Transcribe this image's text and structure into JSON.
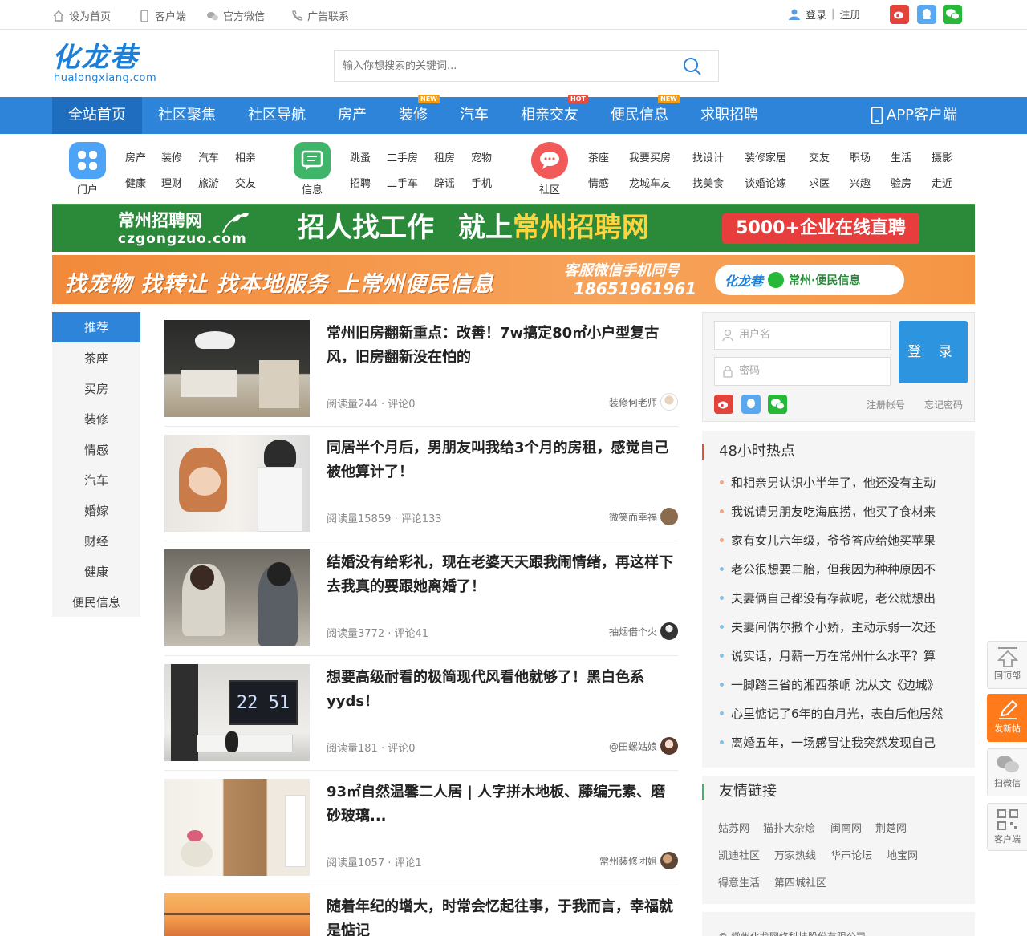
{
  "topbar": {
    "links": [
      "设为首页",
      "客户端",
      "官方微信",
      "广告联系"
    ],
    "login": "登录",
    "separator": "|",
    "register": "注册"
  },
  "logo": {
    "text": "化龙巷",
    "domain": "hualongxiang.com"
  },
  "search": {
    "placeholder": "输入你想搜索的关键词..."
  },
  "nav": {
    "items": [
      "全站首页",
      "社区聚焦",
      "社区导航",
      "房产",
      "装修",
      "汽车",
      "相亲交友",
      "便民信息",
      "求职招聘"
    ],
    "badges": {
      "装修": "NEW",
      "相亲交友": "HOT",
      "便民信息": "NEW"
    },
    "app": "APP客户端",
    "active": "全站首页"
  },
  "catnav": {
    "groups": [
      {
        "label": "门户",
        "links": [
          "房产",
          "装修",
          "汽车",
          "相亲",
          "健康",
          "理财",
          "旅游",
          "交友"
        ]
      },
      {
        "label": "信息",
        "links": [
          "跳蚤",
          "二手房",
          "租房",
          "宠物",
          "招聘",
          "二手车",
          "辟谣",
          "手机"
        ]
      },
      {
        "label": "社区",
        "links": [
          "茶座",
          "我要买房",
          "找设计",
          "装修家居",
          "交友",
          "职场",
          "生活",
          "摄影",
          "情感",
          "龙城车友",
          "找美食",
          "谈婚论嫁",
          "求医",
          "兴趣",
          "验房",
          "走近"
        ]
      }
    ]
  },
  "banner1": {
    "brand": "常州招聘网",
    "brand_domain": "czgongzuo.com",
    "slogan_a": "招人找工作",
    "slogan_b": "就上",
    "slogan_c": "常州招聘网",
    "cta": "5000+企业在线直聘"
  },
  "banner2": {
    "slogan": "找宠物 找转让 找本地服务 上常州便民信息",
    "service_label": "客服微信手机同号",
    "phone": "18651961961",
    "pill_brand": "化龙巷",
    "pill_text": "常州·便民信息"
  },
  "sidebar": {
    "items": [
      "推荐",
      "茶座",
      "买房",
      "装修",
      "情感",
      "汽车",
      "婚嫁",
      "财经",
      "健康",
      "便民信息"
    ],
    "active": "推荐"
  },
  "articles": [
    {
      "title": "常州旧房翻新重点：改善！7w搞定80㎡小户型复古风，旧房翻新没在怕的",
      "meta": "阅读量244 · 评论0",
      "author": "装修何老师"
    },
    {
      "title": "同居半个月后，男朋友叫我给3个月的房租，感觉自己被他算计了！",
      "meta": "阅读量15859 · 评论133",
      "author": "微笑而幸福"
    },
    {
      "title": "结婚没有给彩礼，现在老婆天天跟我闹情绪，再这样下去我真的要跟她离婚了！",
      "meta": "阅读量3772 · 评论41",
      "author": "抽烟借个火"
    },
    {
      "title": "想要高级耐看的极简现代风看他就够了！黑白色系yyds！",
      "meta": "阅读量181 · 评论0",
      "author": "@田螺姑娘",
      "tv_clock": "22 51"
    },
    {
      "title": "93㎡自然温馨二人居 | 人字拼木地板、藤编元素、磨砂玻璃...",
      "meta": "阅读量1057 · 评论1",
      "author": "常州装修团姐"
    },
    {
      "title": "随着年纪的增大，时常会忆起往事，于我而言，幸福就是惦记",
      "meta": "",
      "author": ""
    }
  ],
  "loginbox": {
    "username": "用户名",
    "password": "密码",
    "button": "登 录",
    "register": "注册帐号",
    "forgot": "忘记密码"
  },
  "hot": {
    "title": "48小时热点",
    "items": [
      "和相亲男认识小半年了，他还没有主动",
      "我说请男朋友吃海底捞，他买了食材来",
      "家有女儿六年级，爷爷答应给她买苹果",
      "老公很想要二胎，但我因为种种原因不",
      "夫妻俩自己都没有存款呢，老公就想出",
      "夫妻间偶尔撒个小娇，主动示弱一次还",
      "说实话，月薪一万在常州什么水平？算",
      "一脚踏三省的湘西茶峒 沈从文《边城》",
      "心里惦记了6年的白月光，表白后他居然",
      "离婚五年，一场感冒让我突然发现自己"
    ]
  },
  "friends": {
    "title": "友情链接",
    "links": [
      "姑苏网",
      "猫扑大杂烩",
      "闽南网",
      "荆楚网",
      "凯迪社区",
      "万家热线",
      "华声论坛",
      "地宝网",
      "得意生活",
      "第四城社区"
    ]
  },
  "copyright": "© 常州化龙网络科技股份有限公司",
  "float": {
    "top": "回顶部",
    "post": "发新帖",
    "wechat": "扫微信",
    "client": "客户端"
  },
  "colors": {
    "primary": "#2d84d8",
    "accent": "#e0523a",
    "post": "#ff7a1a"
  }
}
